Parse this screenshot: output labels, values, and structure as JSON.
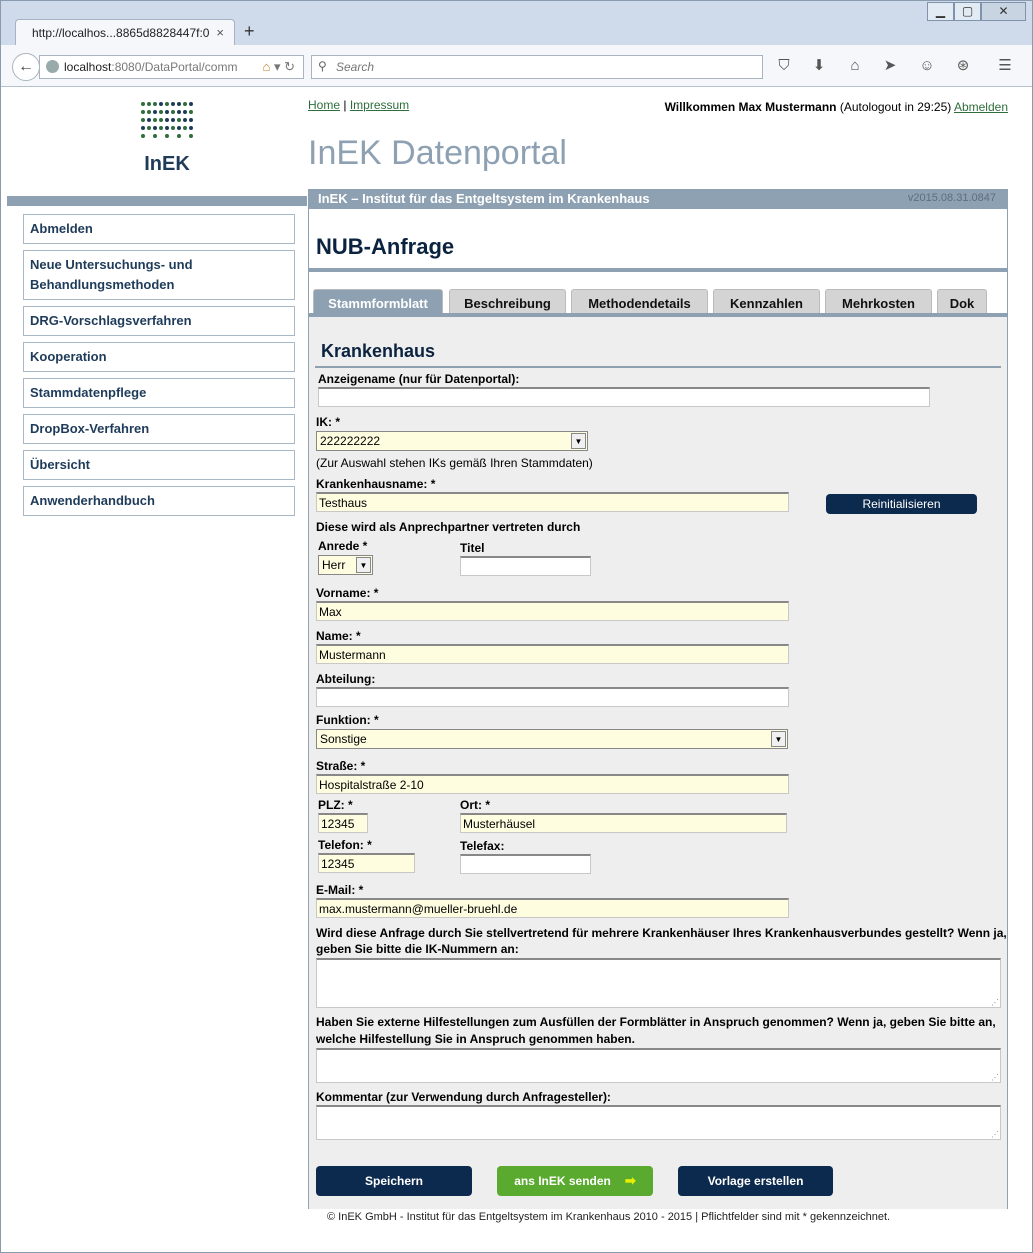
{
  "browser": {
    "tab_title": "http://localhos...8865d8828447f:0",
    "tab_close": "×",
    "new_tab": "+",
    "url_host": "localhost",
    "url_rest": ":8080/DataPortal/comm",
    "search_placeholder": "Search",
    "win_min": "▁",
    "win_max": "▢",
    "win_close": "✕"
  },
  "header": {
    "home": "Home",
    "impressum": "Impressum",
    "welcome_name": "Willkommen Max Mustermann",
    "welcome_logout": "(Autologout in 29:25)",
    "abmelden": "Abmelden",
    "portal_title": "InEK Datenportal",
    "institute": "InEK – Institut für das Entgeltsystem im Krankenhaus",
    "version": "v2015.08.31.0847",
    "logo_text": "InEK"
  },
  "sidebar": {
    "items": [
      {
        "label": "Abmelden"
      },
      {
        "label": "Neue Untersuchungs- und Behandlungsmethoden"
      },
      {
        "label": "DRG-Vorschlagsverfahren"
      },
      {
        "label": "Kooperation"
      },
      {
        "label": "Stammdatenpflege"
      },
      {
        "label": "DropBox-Verfahren"
      },
      {
        "label": "Übersicht"
      },
      {
        "label": "Anwenderhandbuch"
      }
    ]
  },
  "main": {
    "title": "NUB-Anfrage",
    "tabs": [
      {
        "label": "Stammformblatt"
      },
      {
        "label": "Beschreibung"
      },
      {
        "label": "Methodendetails"
      },
      {
        "label": "Kennzahlen"
      },
      {
        "label": "Mehrkosten"
      },
      {
        "label": "Dok"
      }
    ],
    "section_title": "Krankenhaus"
  },
  "form": {
    "anzeigename_label": "Anzeigename (nur für Datenportal):",
    "anzeigename_value": "",
    "ik_label": "IK: *",
    "ik_value": "222222222",
    "ik_note": "(Zur Auswahl stehen IKs gemäß Ihren Stammdaten)",
    "khname_label": "Krankenhausname: *",
    "khname_value": "Testhaus",
    "reinit_label": "Reinitialisieren",
    "ansprech_note": "Diese wird als Anprechpartner vertreten durch",
    "anrede_label": "Anrede *",
    "anrede_value": "Herr",
    "titel_label": "Titel",
    "titel_value": "",
    "vorname_label": "Vorname: *",
    "vorname_value": "Max",
    "name_label": "Name: *",
    "name_value": "Mustermann",
    "abteilung_label": "Abteilung:",
    "abteilung_value": "",
    "funktion_label": "Funktion: *",
    "funktion_value": "Sonstige",
    "strasse_label": "Straße: *",
    "strasse_value": "Hospitalstraße 2-10",
    "plz_label": "PLZ: *",
    "plz_value": "12345",
    "ort_label": "Ort: *",
    "ort_value": "Musterhäusel",
    "telefon_label": "Telefon: *",
    "telefon_value": "12345",
    "telefax_label": "Telefax:",
    "telefax_value": "",
    "email_label": "E-Mail: *",
    "email_value": "max.mustermann@mueller-bruehl.de",
    "q1_line1": "Wird diese Anfrage durch Sie stellvertretend für mehrere Krankenhäuser Ihres Krankenhausverbundes gestellt? Wenn ja,",
    "q1_line2": "geben Sie bitte die IK-Nummern an:",
    "q2_line1": "Haben Sie externe Hilfestellungen zum Ausfüllen der Formblätter in Anspruch genommen? Wenn ja, geben Sie bitte an,",
    "q2_line2": "welche Hilfestellung Sie in Anspruch genommen haben.",
    "kommentar_label": "Kommentar (zur Verwendung durch Anfragesteller):",
    "save_label": "Speichern",
    "send_label": "ans InEK senden",
    "template_label": "Vorlage erstellen"
  },
  "footer": {
    "text": "© InEK GmbH - Institut für das Entgeltsystem im Krankenhaus 2010 - 2015 | Pflichtfelder sind mit * gekennzeichnet."
  }
}
